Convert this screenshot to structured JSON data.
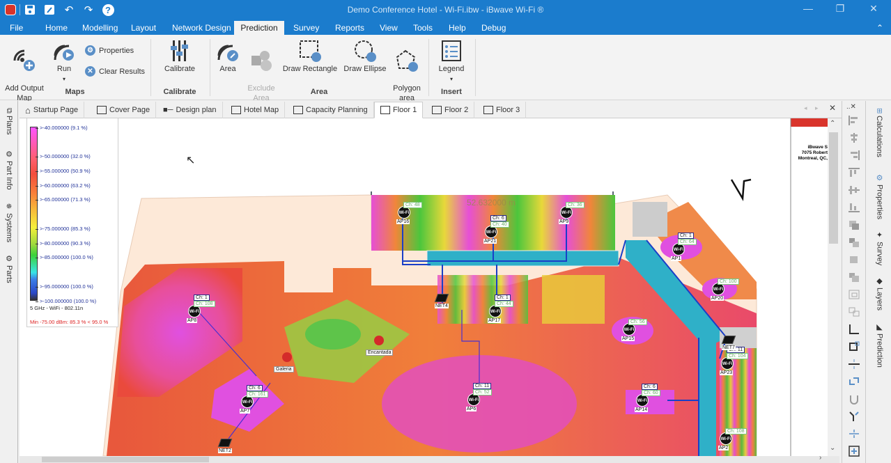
{
  "app": {
    "title": "Demo Conference Hotel - Wi-Fi.ibw - iBwave Wi-Fi ®",
    "window_controls": [
      "minimize",
      "restore",
      "close"
    ]
  },
  "quick_access": [
    {
      "name": "app-logo-icon"
    },
    {
      "name": "save-icon"
    },
    {
      "name": "save-as-icon"
    },
    {
      "name": "undo-icon"
    },
    {
      "name": "redo-icon"
    },
    {
      "name": "help-icon"
    }
  ],
  "menu": {
    "items": [
      "File",
      "Home",
      "Modelling",
      "Layout",
      "Network Design",
      "Prediction",
      "Survey",
      "Reports",
      "View",
      "Tools",
      "Help",
      "Debug"
    ],
    "active": "Prediction"
  },
  "ribbon": {
    "groups": [
      {
        "label": "Maps",
        "buttons": [
          "Add Output Map",
          "Run",
          "Properties",
          "Clear Results"
        ]
      },
      {
        "label": "Calibrate",
        "buttons": [
          "Calibrate"
        ]
      },
      {
        "label": "Area",
        "buttons": [
          "Area",
          "Exclude Area",
          "Draw Rectangle",
          "Draw Ellipse",
          "Polygon area"
        ]
      },
      {
        "label": "Insert",
        "buttons": [
          "Legend"
        ]
      }
    ],
    "add_output_map": "Add Output\nMap",
    "run": "Run",
    "properties": "Properties",
    "clear_results": "Clear Results",
    "calibrate": "Calibrate",
    "area": "Area",
    "exclude_area": "Exclude\nArea",
    "draw_rectangle": "Draw Rectangle",
    "draw_ellipse": "Draw Ellipse",
    "polygon_area": "Polygon\narea",
    "legend": "Legend",
    "group_maps": "Maps",
    "group_calibrate": "Calibrate",
    "group_area": "Area",
    "group_insert": "Insert"
  },
  "tabs": {
    "items": [
      "Startup Page",
      "Cover Page",
      "Design plan",
      "Hotel Map",
      "Capacity Planning",
      "Floor 1",
      "Floor 2",
      "Floor 3"
    ],
    "active": "Floor 1"
  },
  "left_panels": [
    "Plans",
    "Part Info",
    "Systems",
    "Parts"
  ],
  "right_panels": [
    "Calculations",
    "Properties",
    "Survey",
    "Layers",
    "Prediction"
  ],
  "legend": {
    "entries": [
      ">-40.000000 (9.1 %)",
      ">-50.000000 (32.0 %)",
      ">-55.000000 (50.9 %)",
      ">-60.000000 (63.2 %)",
      ">-65.000000 (71.3 %)",
      ">-75.000000 (85.3 %)",
      ">-80.000000 (90.3 %)",
      ">-85.000000 (100.0 %)",
      ">-95.000000 (100.0 %)",
      ">-100.000000 (100.0 %)"
    ],
    "band": "5 GHz - WiFi - 802.11n",
    "min_line": "Min -75.00 dBm: 85.3 % < 95.0 %"
  },
  "floorplan": {
    "measurement": "52.632000 m",
    "company_block": [
      "iBwave S",
      "7075 Robert",
      "Montreal, QC,"
    ],
    "access_points": [
      {
        "label": "AP16",
        "ch": [
          "Ch: 48"
        ]
      },
      {
        "label": "AP21",
        "ch": [
          "Ch: 6",
          "Ch: 40"
        ]
      },
      {
        "label": "AP9",
        "ch": [
          "Ch: 36"
        ]
      },
      {
        "label": "AP1",
        "ch": [
          "Ch: 1",
          "Ch: 64"
        ]
      },
      {
        "label": "AP20",
        "ch": [
          "Ch: 100"
        ]
      },
      {
        "label": "AP8",
        "ch": [
          "Ch: 1",
          "Ch: 108"
        ]
      },
      {
        "label": "AP17",
        "ch": [
          "Ch: 1",
          "Ch: 44"
        ]
      },
      {
        "label": "AP15",
        "ch": [
          "Ch: 56"
        ]
      },
      {
        "label": "AP23",
        "ch": [
          "Ch: 11",
          "Ch: 104"
        ]
      },
      {
        "label": "AP7",
        "ch": [
          "Ch: 6",
          "Ch: 161"
        ]
      },
      {
        "label": "AP6",
        "ch": [
          "Ch: 11",
          "Ch: 52"
        ]
      },
      {
        "label": "AP14",
        "ch": [
          "Ch: 6",
          "Ch: 60"
        ]
      },
      {
        "label": "AP2",
        "ch": [
          "Ch: 108"
        ]
      }
    ],
    "switches": [
      "NET4",
      "NET7",
      "NET2"
    ],
    "rooms": [
      "Galeria",
      "Encantada"
    ],
    "ap_icon_text": "Wi-Fi"
  }
}
